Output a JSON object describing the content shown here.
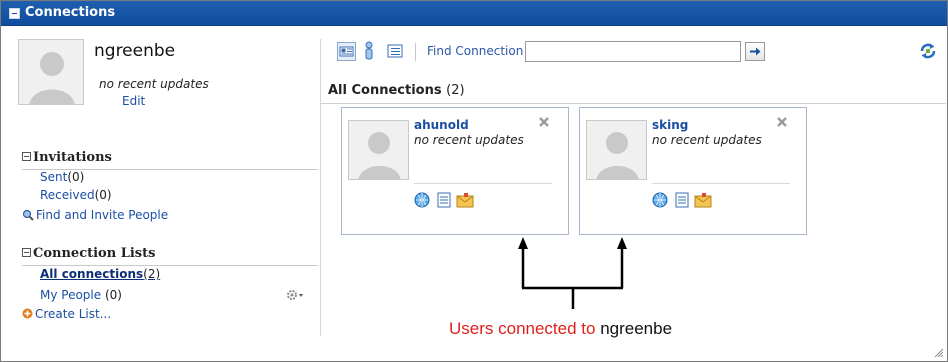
{
  "window": {
    "title": "Connections"
  },
  "profile": {
    "username": "ngreenbe",
    "status": "no recent updates",
    "edit_label": "Edit"
  },
  "invitations": {
    "heading": "Invitations",
    "sent_label": "Sent",
    "sent_count": "(0)",
    "received_label": "Received",
    "received_count": "(0)",
    "find_invite_label": "Find and Invite People"
  },
  "connection_lists": {
    "heading": "Connection Lists",
    "all_label": "All connections",
    "all_count": "(2)",
    "my_people_label": "My People",
    "my_people_count": "(0)",
    "create_list_label": "Create List..."
  },
  "toolbar": {
    "find_label": "Find Connection",
    "find_value": "",
    "icons": [
      "card-view-icon",
      "person-view-icon",
      "list-view-icon",
      "go-arrow-icon",
      "refresh-icon"
    ]
  },
  "main": {
    "heading": "All Connections",
    "heading_count": "(2)",
    "cards": [
      {
        "name": "ahunold",
        "status": "no recent updates"
      },
      {
        "name": "sking",
        "status": "no recent updates"
      }
    ]
  },
  "annotation": {
    "text_red": "Users connected to",
    "text_black": "ngreenbe"
  },
  "colors": {
    "titlebar": "#0f4c9d",
    "link": "#1b4fa3",
    "annotation_red": "#e0211b"
  }
}
